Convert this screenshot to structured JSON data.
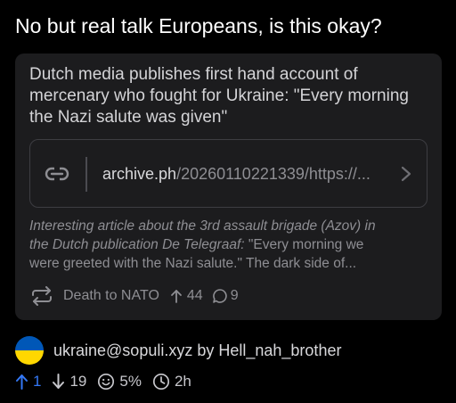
{
  "post": {
    "title": "No but real talk Europeans, is this okay?"
  },
  "crosspost": {
    "title": "Dutch media publishes first hand account of mercenary who fought for Ukraine: \"Every morning the Nazi salute was given\"",
    "link": {
      "host": "archive.ph",
      "path": "/20260110221339/https://..."
    },
    "description": {
      "line1_italic": "Interesting article about the 3rd assault brigade (Azov) in",
      "line2_italic": "the Dutch publication De Telegraaf:",
      "line2_rest": " \"Every morning we",
      "line3": "were greeted with the Nazi salute.\" The dark side of..."
    },
    "footer": {
      "community": "Death to NATO",
      "upvotes": "44",
      "comments": "9"
    }
  },
  "meta": {
    "community": "ukraine@sopuli.xyz",
    "by": "by",
    "author": "Hell_nah_brother"
  },
  "stats": {
    "upvotes": "1",
    "downvotes": "19",
    "ratio": "5%",
    "age": "2h"
  },
  "colors": {
    "accent": "#3478f6",
    "card_bg": "#1c1c1e",
    "muted": "#8e8e93",
    "flag_blue": "#0057b7",
    "flag_yellow": "#ffd700"
  },
  "icons": {
    "link": "link-icon",
    "chevron": "chevron-right-icon",
    "repost": "repost-icon",
    "upvote": "arrow-up-icon",
    "downvote": "arrow-down-icon",
    "comments": "chat-bubble-icon",
    "ratio": "smiley-icon",
    "age": "clock-icon"
  }
}
